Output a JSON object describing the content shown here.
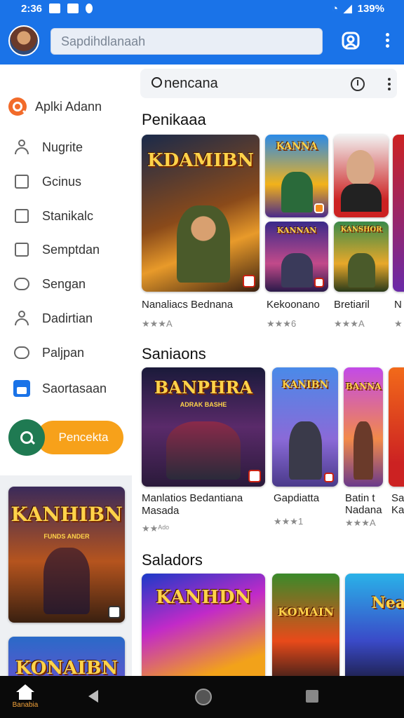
{
  "status": {
    "time": "2:36",
    "battery": "139%"
  },
  "appbar": {
    "search_placeholder": "Sapdihdlanaah"
  },
  "drawer": {
    "items": [
      {
        "label": "Aplki Adann",
        "icon": "search-icon"
      },
      {
        "label": "Nugrite",
        "icon": "person-icon"
      },
      {
        "label": "Gcinus",
        "icon": "image-icon"
      },
      {
        "label": "Stanikalc",
        "icon": "checkbox-icon"
      },
      {
        "label": "Semptdan",
        "icon": "checkbox-icon"
      },
      {
        "label": "Sengan",
        "icon": "chat-icon"
      },
      {
        "label": "Dadirtian",
        "icon": "person-icon"
      },
      {
        "label": "Paljpan",
        "icon": "chat-icon"
      },
      {
        "label": "Saortasaan",
        "icon": "save-icon"
      }
    ],
    "search_button_label": "Pencekta",
    "promo_cards": [
      {
        "title": "KANHIBN",
        "subtitle": "FUNDS ANDER"
      },
      {
        "title": "KONAIBN"
      }
    ]
  },
  "main": {
    "search_query": "nencana",
    "sections": [
      {
        "title": "Penikaaa",
        "cards": [
          {
            "art_text": "KDAMIBN",
            "title": "Nanaliacs Bednana",
            "rating": "★★★A"
          },
          {
            "art_text": "KANNA",
            "title": "Kekoonano",
            "rating": "★★★6"
          },
          {
            "art_text": "",
            "title": "Bretiaril",
            "rating": "★★★A"
          },
          {
            "art_text": "",
            "title": "N",
            "rating": "★"
          },
          {
            "art_text": "KANNAN",
            "title": "",
            "rating": ""
          },
          {
            "art_text": "KANSHOR",
            "title": "",
            "rating": ""
          }
        ]
      },
      {
        "title": "Saniaons",
        "cards": [
          {
            "art_text": "BANPHRA",
            "art_sub": "ADRAK BASHE",
            "title": "Manlatios Bedantiana Masada",
            "rating": "★★ᴬᵈᵒ"
          },
          {
            "art_text": "KANIBN",
            "title": "Gapdiatta",
            "rating": "★★★1"
          },
          {
            "art_text": "BANNA",
            "title": "Batin t Nadana",
            "rating": "★★★A"
          },
          {
            "art_text": "",
            "title": "Sa Ka",
            "rating": ""
          }
        ]
      },
      {
        "title": "Saladors",
        "cards": [
          {
            "art_text": "KANHDN",
            "title": "",
            "rating": ""
          },
          {
            "art_text": "KOMAIN",
            "title": "",
            "rating": ""
          },
          {
            "art_text": "Nea",
            "title": "",
            "rating": ""
          }
        ]
      }
    ]
  },
  "navbar": {
    "home_label": "Banabia"
  },
  "colors": {
    "primary": "#1a73e8",
    "orange": "#f7a11a",
    "green": "#1f7a52"
  }
}
